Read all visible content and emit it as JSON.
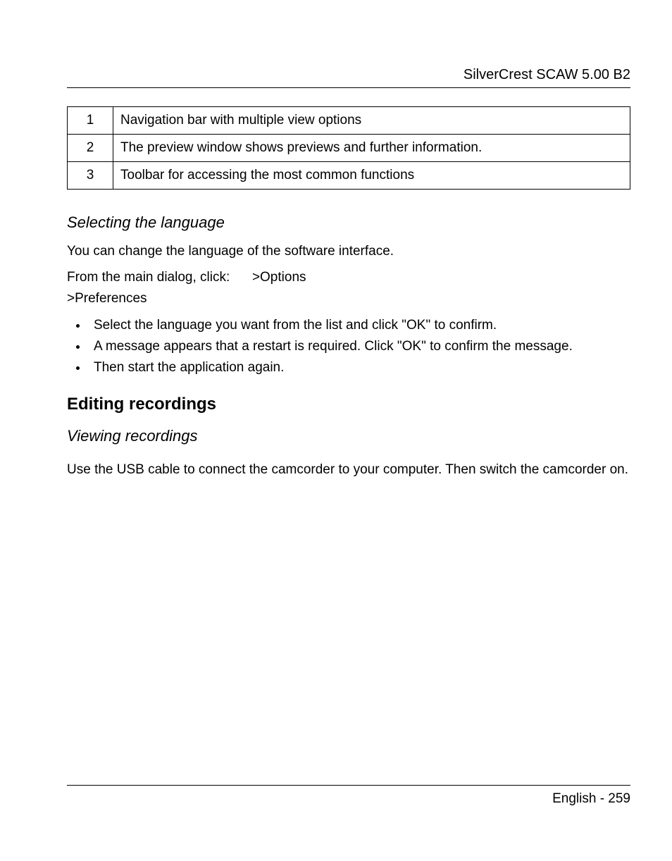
{
  "header": {
    "title": "SilverCrest SCAW 5.00 B2"
  },
  "table": {
    "rows": [
      {
        "num": "1",
        "desc": "Navigation bar with multiple view options"
      },
      {
        "num": "2",
        "desc": "The preview window shows previews and further information."
      },
      {
        "num": "3",
        "desc": "Toolbar for accessing the most common functions"
      }
    ]
  },
  "section1": {
    "heading": "Selecting the language",
    "p1": "You can change the language of the software interface.",
    "p2a": "From the main dialog, click:",
    "p2b": ">Options",
    "p3": ">Preferences",
    "bullets": [
      "Select the language you want from the list and click \"OK\" to confirm.",
      "A message appears that a restart is required. Click \"OK\" to confirm the message.",
      "Then start the application again."
    ]
  },
  "section2": {
    "heading": "Editing recordings",
    "sub": "Viewing recordings",
    "body": "Use the USB cable to connect the camcorder to your computer. Then switch the camcorder on."
  },
  "footer": {
    "text": "English - 259"
  }
}
